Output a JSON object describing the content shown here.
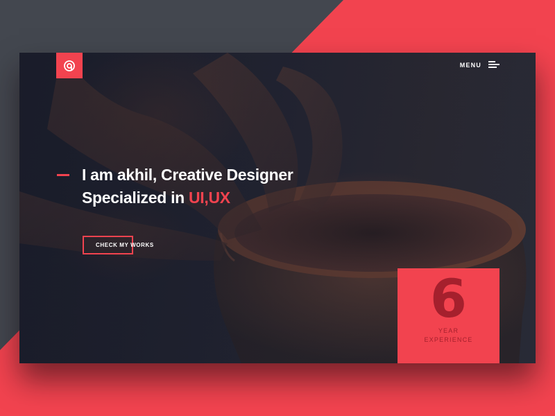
{
  "logo": {
    "icon": "spiral-a-icon"
  },
  "menu": {
    "label": "MENU",
    "icon": "hamburger-icon"
  },
  "hero": {
    "line1": "I am akhil, Creative Designer",
    "line2_prefix": "Specialized in ",
    "line2_accent": "UI,UX",
    "cta_label": "CHECK MY WORKS"
  },
  "experience": {
    "number": "6",
    "line1": "YEAR",
    "line2": "EXPERIENCE"
  },
  "colors": {
    "accent": "#f2434f",
    "dark_accent": "#a5202d",
    "background_gray": "#43474f",
    "card_dark": "#1e2130"
  }
}
